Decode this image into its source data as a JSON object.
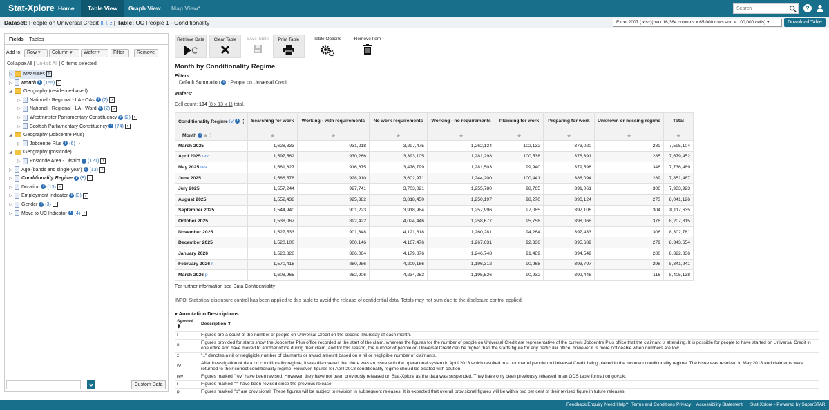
{
  "app": {
    "logo": "Stat-Xplore",
    "nav": [
      "Home",
      "Table View",
      "Graph View",
      "Map View*"
    ],
    "search_placeholder": "Search"
  },
  "dataset": {
    "prefix": "Dataset:",
    "name": "People on Universal Credit",
    "annotations": "II, I, z",
    "table_prefix": "Table:",
    "table_name": "UC People 1 - Conditionality",
    "format": "Excel 2007 (.xlsx)(max 16,384 columns x 65,000 rows and < 100,000 cells)",
    "download": "Download Table"
  },
  "left": {
    "tabs": [
      "Fields",
      "Tables"
    ],
    "add_to": "Add to:",
    "buttons": [
      "Row",
      "Column",
      "Wafer",
      "Filter",
      "Remove"
    ],
    "collapse_all": "Collapse All",
    "untick_all": "Un-tick All",
    "selected": "0 items selected.",
    "custom_data": "Custom Data",
    "tree": [
      {
        "label": "Measures",
        "count": ""
      },
      {
        "label": "Month",
        "count": "(155)"
      },
      {
        "label": "Geography (residence-based)",
        "count": ""
      },
      {
        "label": "National - Regional - LA - OAs",
        "count": "(2)"
      },
      {
        "label": "National - Regional - LA - Ward",
        "count": "(2)"
      },
      {
        "label": "Westminster Parliamentary Constituency",
        "count": "(2)"
      },
      {
        "label": "Scottish Parliamentary Constituency",
        "count": "(74)"
      },
      {
        "label": "Geography (Jobcentre Plus)",
        "count": ""
      },
      {
        "label": "Jobcentre Plus",
        "count": "(6)"
      },
      {
        "label": "Geography (postcode)",
        "count": ""
      },
      {
        "label": "Postcode Area - District",
        "count": "(121)"
      },
      {
        "label": "Age (bands and single year)",
        "count": "(13)"
      },
      {
        "label": "Conditionality Regime",
        "count": "(8)"
      },
      {
        "label": "Duration",
        "count": "(13)"
      },
      {
        "label": "Employment indicator",
        "count": "(3)"
      },
      {
        "label": "Gender",
        "count": "(3)"
      },
      {
        "label": "Move to UC Indicator",
        "count": "(4)"
      }
    ]
  },
  "toolbar": {
    "retrieve": "Retrieve Data",
    "clear": "Clear Table",
    "save": "Save Table",
    "print": "Print Table",
    "options": "Table Options",
    "remove": "Remove Item"
  },
  "table": {
    "title": "Month by Conditionality Regime",
    "filters_h": "Filters:",
    "filter_line_a": "Default Summation",
    "filter_line_b": ": People on Universal Credit",
    "wafers_h": "Wafers:",
    "cellcount_a": "Cell count:",
    "cellcount_n": "104",
    "cellcount_b": "(8 x 13 x 1)",
    "cellcount_c": "total.",
    "corner_label": "Conditionality Regime",
    "corner_ann": "IV",
    "row_dim": "Month",
    "columns": [
      "Searching for work",
      "Working - with requirements",
      "No work requirements",
      "Working - no requirements",
      "Planning for work",
      "Preparing for work",
      "Unknown or missing regime",
      "Total"
    ],
    "rows": [
      {
        "month": "March 2025",
        "ann": "",
        "values": [
          "1,628,833",
          "931,218",
          "3,297,475",
          "1,262,134",
          "102,132",
          "373,020",
          "289",
          "7,595,104"
        ]
      },
      {
        "month": "April 2025",
        "ann": "rev",
        "values": [
          "1,597,562",
          "930,266",
          "3,393,105",
          "1,281,298",
          "100,538",
          "376,391",
          "285",
          "7,679,452"
        ]
      },
      {
        "month": "May 2025",
        "ann": "rev",
        "values": [
          "1,581,627",
          "916,675",
          "3,476,799",
          "1,281,503",
          "99,940",
          "379,598",
          "346",
          "7,736,489"
        ]
      },
      {
        "month": "June 2025",
        "ann": "",
        "values": [
          "1,586,578",
          "928,910",
          "3,602,971",
          "1,244,200",
          "100,441",
          "388,094",
          "289",
          "7,851,487"
        ]
      },
      {
        "month": "July 2025",
        "ann": "",
        "values": [
          "1,557,244",
          "927,741",
          "3,703,021",
          "1,255,780",
          "98,765",
          "391,061",
          "306",
          "7,933,923"
        ]
      },
      {
        "month": "August 2025",
        "ann": "",
        "values": [
          "1,552,438",
          "925,382",
          "3,818,450",
          "1,250,197",
          "98,270",
          "396,124",
          "273",
          "8,041,126"
        ]
      },
      {
        "month": "September 2025",
        "ann": "",
        "values": [
          "1,544,940",
          "901,223",
          "3,918,984",
          "1,257,996",
          "97,085",
          "397,106",
          "304",
          "8,117,635"
        ]
      },
      {
        "month": "October 2025",
        "ann": "",
        "values": [
          "1,538,067",
          "892,422",
          "4,024,446",
          "1,258,677",
          "95,758",
          "398,068",
          "376",
          "8,207,815"
        ]
      },
      {
        "month": "November 2025",
        "ann": "",
        "values": [
          "1,527,533",
          "901,348",
          "4,121,618",
          "1,260,281",
          "94,264",
          "397,433",
          "308",
          "8,302,781"
        ]
      },
      {
        "month": "December 2025",
        "ann": "",
        "values": [
          "1,520,100",
          "900,146",
          "4,167,476",
          "1,267,631",
          "92,336",
          "395,689",
          "279",
          "8,343,654"
        ]
      },
      {
        "month": "January 2026",
        "ann": "",
        "values": [
          "1,523,828",
          "886,064",
          "4,179,876",
          "1,246,748",
          "91,489",
          "394,549",
          "286",
          "8,322,836"
        ]
      },
      {
        "month": "February 2026",
        "ann": "r",
        "values": [
          "1,570,418",
          "880,986",
          "4,209,166",
          "1,196,312",
          "90,968",
          "393,797",
          "298",
          "8,341,941"
        ]
      },
      {
        "month": "March 2026",
        "ann": "p",
        "values": [
          "1,608,965",
          "882,906",
          "4,234,253",
          "1,195,526",
          "90,932",
          "392,448",
          "116",
          "8,405,138"
        ]
      }
    ],
    "further_info_a": "For further information see",
    "further_info_link": "Data Confidentiality",
    "info": "INFO: Statistical disclosure control has been applied to this table to avoid the release of confidential data. Totals may not sum due to the disclosure control applied."
  },
  "annotations": {
    "heading": "Annotation Descriptions",
    "col_symbol": "Symbol",
    "col_desc": "Description",
    "items": [
      {
        "symbol": "I",
        "desc": "Figures are a count of the number of people on Universal Credit on the second Thursday of each month."
      },
      {
        "symbol": "II",
        "desc": "Figures provided for starts show the Jobcentre Plus office recorded at the start of the claim, whereas the figures for the number of people on Universal Credit are representative of the current Jobcentre Plus office that the claimant is attending. It is possible for people to have started on Universal Credit in one office and have moved to another office during their claim, and for this reason, the number of people on Universal Credit can be higher than the starts figure for any particular office, however it is more noticeable when numbers are low."
      },
      {
        "symbol": "z",
        "desc": "\"..\" denotes a nil or negligible number of claimants or award amount based on a nil or negligible number of claimants."
      },
      {
        "symbol": "IV",
        "desc": "After investigation of data on conditionality regime, it was discovered that there was an issue with the operational system in April 2018 which resulted in a number of people on Universal Credit being placed in the incorrect conditionality regime. The issue was resolved in May 2018 and claimants were returned to their correct conditionality regime. However, figures for April 2018 conditionality regime should be treated with caution."
      },
      {
        "symbol": "rev",
        "desc": "Figures marked \"rev\" have been revised. However, they have not been previously released on Stat-Xplore as the data was suspended. They have only been previously released in an ODS table format on gov.uk."
      },
      {
        "symbol": "r",
        "desc": "Figures marked \"r\" have been revised since the previous release."
      },
      {
        "symbol": "p",
        "desc": "Figures marked \"p\" are provisional. These figures will be subject to revision in subsequent releases. It is expected that overall provisional figures will be within two per cent of their revised figure in future releases."
      }
    ]
  },
  "footer": {
    "links": [
      "Feedback/Enquiry",
      "Need Help?",
      "Terms and Conditions",
      "Privacy",
      "Accessibility Statement"
    ],
    "powered": "Stat-Xplore - Powered by SuperSTAR"
  },
  "colors": {
    "brand": "#176f8c",
    "link": "#3b7dd8"
  },
  "icons": [
    "search-icon",
    "help-icon",
    "user-icon",
    "folder-icon",
    "info-icon",
    "play-icon",
    "refresh-icon",
    "close-icon",
    "save-icon",
    "print-icon",
    "gears-icon",
    "trash-icon"
  ]
}
